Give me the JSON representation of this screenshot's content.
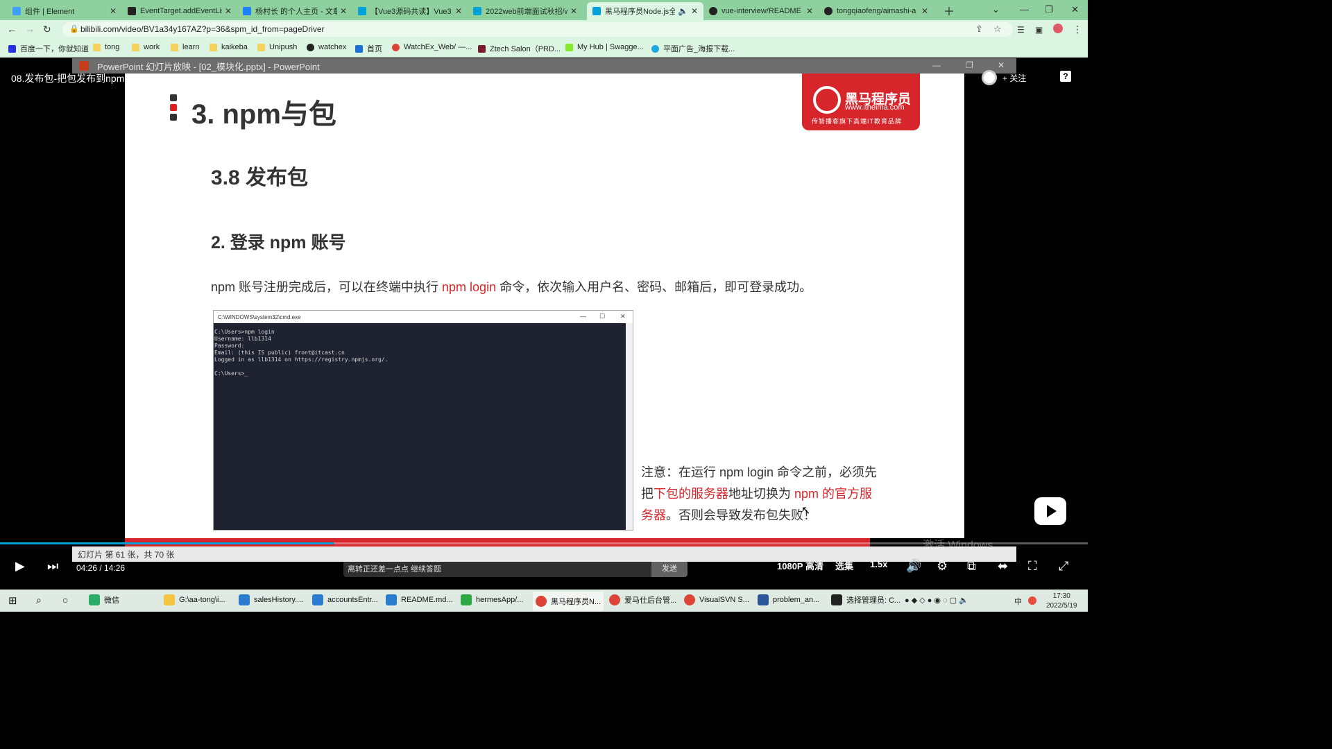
{
  "browser": {
    "tabs": [
      {
        "title": "组件 | Element",
        "color": "#409eff"
      },
      {
        "title": "EventTarget.addEventLis",
        "color": "#222222"
      },
      {
        "title": "杨村长 的个人主页 - 文章",
        "color": "#1e80ff"
      },
      {
        "title": "【Vue3源码共读】Vue3源",
        "color": "#00a1d6"
      },
      {
        "title": "2022web前端面试秋招/w",
        "color": "#00a1d6"
      },
      {
        "title": "黑马程序员Node.js全",
        "color": "#00a1d6"
      },
      {
        "title": "vue-interview/README",
        "color": "#222222"
      },
      {
        "title": "tongqiaofeng/aimashi-a",
        "color": "#222222"
      }
    ],
    "url": "bilibili.com/video/BV1a34y167AZ?p=36&spm_id_from=pageDriver",
    "bookmarks": [
      "百度一下，你就知道",
      "tong",
      "work",
      "learn",
      "kaikeba",
      "Unipush",
      "watchex",
      "首页",
      "WatchEx_Web/ —...",
      "Ztech Salon（PRD...",
      "My Hub | Swagge...",
      "平面广告_海报下载..."
    ]
  },
  "ppt": {
    "window_title": "PowerPoint 幻灯片放映 - [02_模块化.pptx] - PowerPoint",
    "status": "幻灯片 第 61 张，共 70 张"
  },
  "video": {
    "title": "08.发布包-把包发布到npm",
    "follow_label": "+ 关注",
    "help_label": "?",
    "time": "04:26 / 14:26",
    "quality": "1080P 高清",
    "episodes": "选集",
    "speed": "1.5x",
    "danmaku_placeholder": "离转正还差一点点 继续答题",
    "send_label": "发送",
    "watermark": "激活 Windows",
    "progress_fraction": 0.307
  },
  "slide": {
    "title": "3. npm与包",
    "logo_name": "黑马程序员",
    "logo_site": "www.itheima.com",
    "logo_slogan": "传智播客旗下高端IT教育品牌",
    "h2": "3.8 发布包",
    "h3": "2. 登录 npm 账号",
    "p_before": "npm 账号注册完成后，可以在终端中执行 ",
    "p_red": "npm login",
    "p_after": " 命令，依次输入用户名、密码、邮箱后，即可登录成功。",
    "cmd_title": "C:\\WINDOWS\\system32\\cmd.exe",
    "cmd_text": "C:\\Users>npm login\nUsername: llb1314\nPassword:\nEmail: (this IS public) front@itcast.cn\nLogged in as llb1314 on https://registry.npmjs.org/.\n\nC:\\Users>_",
    "note_1": "注意：在运行 npm login 命令之前，必须先把",
    "note_red_1": "下包的服务器",
    "note_2": "地址切换为 ",
    "note_red_2": "npm 的官方服务器",
    "note_3": "。否则会导致发布包失败！"
  },
  "taskbar": {
    "items": [
      "微信",
      "G:\\aa-tong\\i...",
      "salesHistory....",
      "accountsEntr...",
      "README.md...",
      "hermesApp/...",
      "黑马程序员N...",
      "爱马仕后台管...",
      "VisualSVN S...",
      "problem_an...",
      "选择管理员: C..."
    ],
    "ime": "中",
    "time": "17:30",
    "date": "2022/5/19"
  }
}
